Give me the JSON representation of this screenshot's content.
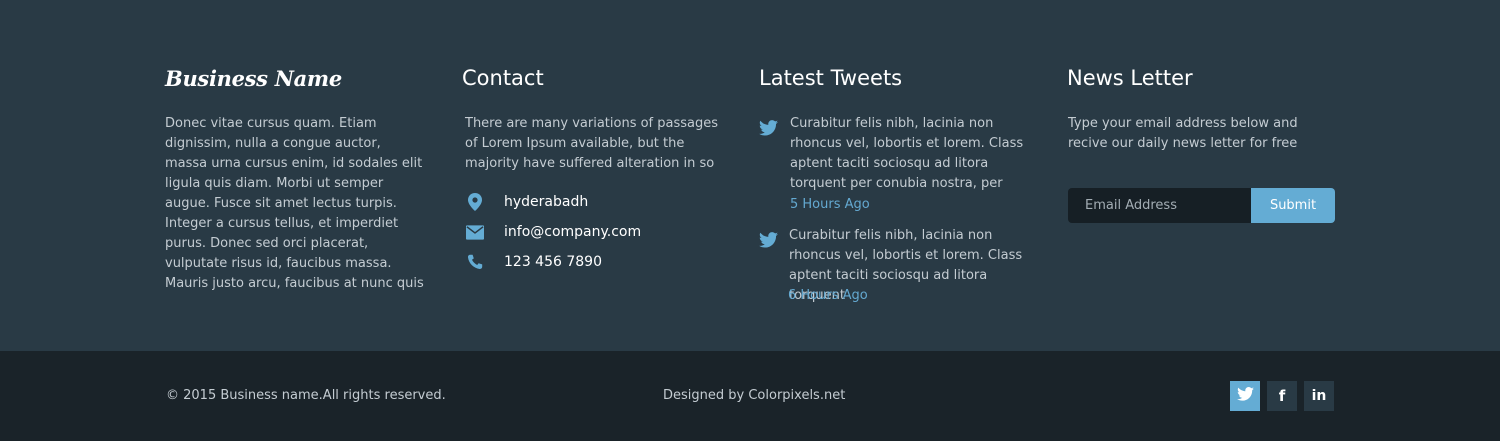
{
  "brand": {
    "name": "Business Name"
  },
  "about": {
    "text": "Donec vitae cursus quam. Etiam dignissim, nulla a congue auctor, massa urna cursus enim, id sodales elit ligula quis diam. Morbi ut semper augue. Fusce sit amet lectus turpis. Integer a cursus tellus, et imperdiet purus. Donec sed orci placerat, vulputate risus id, faucibus massa. Mauris justo arcu, faucibus at nunc quis"
  },
  "contact": {
    "title": "Contact",
    "text": "There are many variations of passages of Lorem Ipsum available, but the majority have suffered alteration in so",
    "items": [
      {
        "icon": "map-marker-icon",
        "text": "hyderabadh"
      },
      {
        "icon": "envelope-icon",
        "text": "info@company.com"
      },
      {
        "icon": "phone-icon",
        "text": "123 456 7890"
      }
    ]
  },
  "tweets": {
    "title": "Latest Tweets",
    "items": [
      {
        "text": "Curabitur felis nibh, lacinia non rhoncus vel, lobortis et lorem. Class aptent taciti sociosqu ad litora torquent per conubia nostra, per",
        "time": "5 Hours  Ago"
      },
      {
        "text": "Curabitur felis nibh, lacinia non rhoncus vel, lobortis et lorem. Class aptent taciti sociosqu ad litora torquent",
        "time": "6 Hours Ago"
      }
    ]
  },
  "newsletter": {
    "title": "News Letter",
    "text": "Type your email address below and recive our daily news letter for free",
    "placeholder": "Email Address",
    "submit_label": "Submit"
  },
  "bottom": {
    "copyright": "© 2015 Business name.All rights reserved.",
    "designed": "Designed by Colorpixels.net",
    "social": [
      {
        "icon": "twitter-icon",
        "label": ""
      },
      {
        "icon": "facebook-icon",
        "label": "f"
      },
      {
        "icon": "linkedin-icon",
        "label": "in"
      }
    ]
  },
  "colors": {
    "top_bg": "#293a45",
    "bottom_bg": "#1a2329",
    "accent": "#64acd4",
    "text": "#c4ccd2"
  }
}
